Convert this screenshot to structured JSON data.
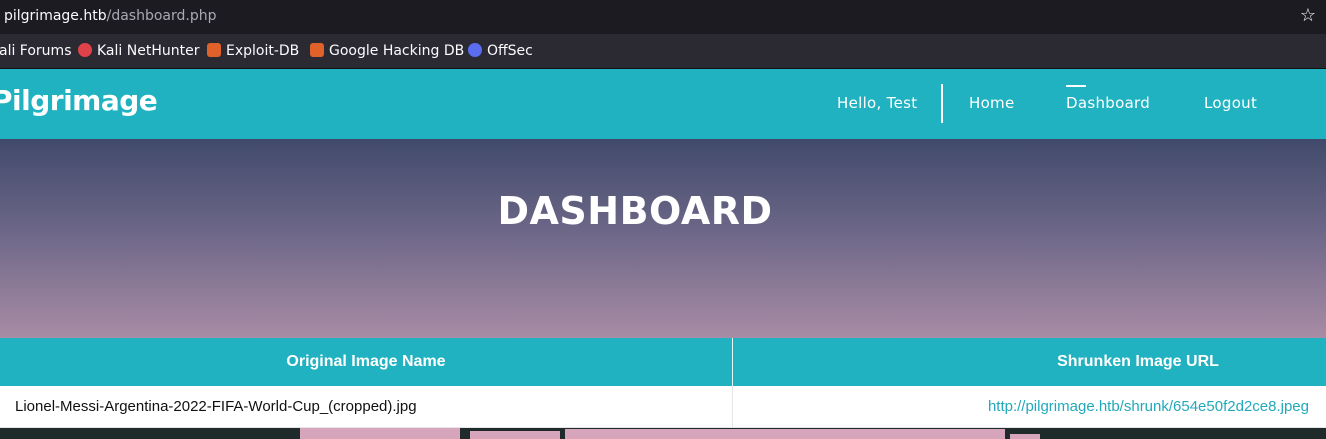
{
  "browser": {
    "url_host": "pilgrimage.htb",
    "url_path": "/dashboard.php",
    "bookmarks": [
      {
        "label": "ali Forums",
        "icon": "kali-icon"
      },
      {
        "label": "Kali NetHunter",
        "icon": "nethunter-icon",
        "color": "#e0424a"
      },
      {
        "label": "Exploit-DB",
        "icon": "exploitdb-icon",
        "color": "#e0622a"
      },
      {
        "label": "Google Hacking DB",
        "icon": "ghdb-icon",
        "color": "#e0622a"
      },
      {
        "label": "OffSec",
        "icon": "offsec-icon",
        "color": "#5a6cf0"
      }
    ]
  },
  "navbar": {
    "brand": "Pilgrimage",
    "greeting": "Hello, Test",
    "links": [
      "Home",
      "Dashboard",
      "Logout"
    ],
    "active": "Dashboard",
    "color": "#21b2c1"
  },
  "hero": {
    "title": "DASHBOARD"
  },
  "table": {
    "headers": [
      "Original Image Name",
      "Shrunken Image URL"
    ],
    "rows": [
      {
        "original": "Lionel-Messi-Argentina-2022-FIFA-World-Cup_(cropped).jpg",
        "url": "http://pilgrimage.htb/shrunk/654e50f2d2ce8.jpeg"
      }
    ]
  }
}
